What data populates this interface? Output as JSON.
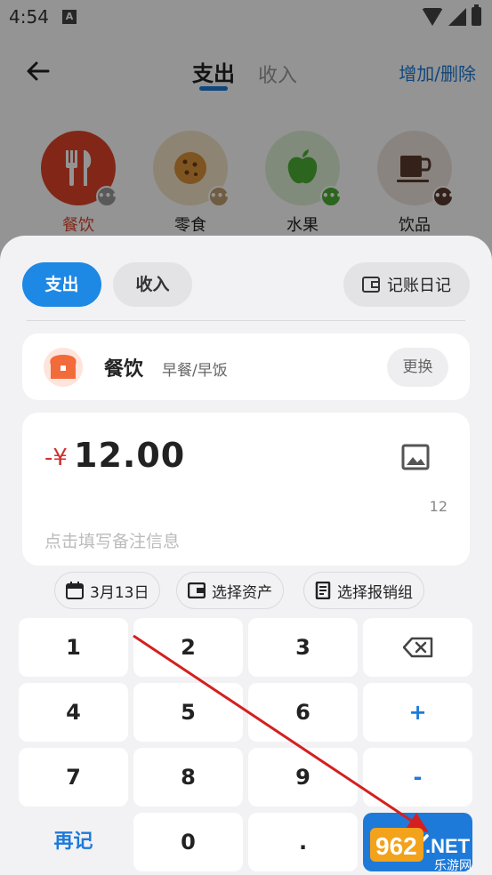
{
  "status_bar": {
    "time": "4:54",
    "notification_letter": "A"
  },
  "top_nav": {
    "tab_expense": "支出",
    "tab_income": "收入",
    "add_delete": "增加/删除"
  },
  "categories": [
    {
      "label": "餐饮",
      "color": "#e0442a",
      "icon": "fork-knife-icon"
    },
    {
      "label": "零食",
      "color": "#f3e3c7",
      "icon": "cookie-icon"
    },
    {
      "label": "水果",
      "color": "#dcefd5",
      "icon": "apple-icon"
    },
    {
      "label": "饮品",
      "color": "#eee4df",
      "icon": "cup-icon"
    }
  ],
  "sheet": {
    "seg_expense": "支出",
    "seg_income": "收入",
    "diary_button": "记账日记",
    "category_name": "餐饮",
    "category_sub": "早餐/早饭",
    "change_button": "更换",
    "amount_sign": "-¥",
    "amount_value": "12.00",
    "char_count": "12",
    "note_placeholder": "点击填写备注信息",
    "date_chip": "3月13日",
    "asset_chip": "选择资产",
    "reimburse_chip": "选择报销组"
  },
  "keypad": {
    "k1": "1",
    "k2": "2",
    "k3": "3",
    "k4": "4",
    "k5": "5",
    "k6": "6",
    "k7": "7",
    "k8": "8",
    "k9": "9",
    "plus": "+",
    "minus": "-",
    "recall": "再记",
    "k0": "0",
    "dot": "."
  },
  "watermark": {
    "number": "962",
    "domain": ".NET",
    "site": "乐游网"
  },
  "colors": {
    "accent": "#1e7ad8",
    "expense_red": "#d32f2f",
    "annotation_arrow": "#d42020"
  }
}
